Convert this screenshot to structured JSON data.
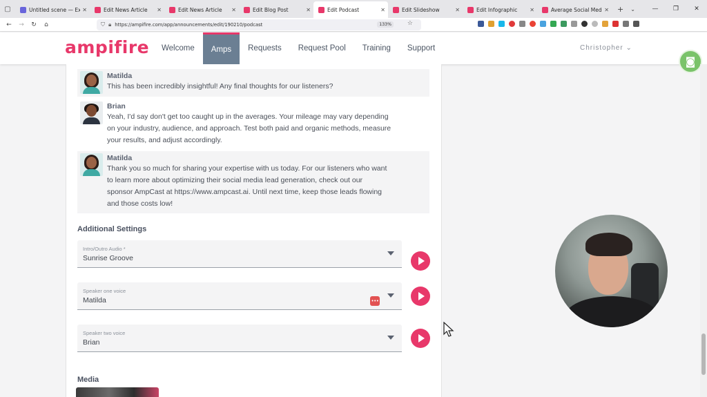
{
  "browser": {
    "tabs": [
      {
        "title": "Untitled scene — Excalidraw",
        "favicon_color": "#6965db",
        "active": false
      },
      {
        "title": "Edit News Article",
        "favicon_color": "#e8386a",
        "active": false
      },
      {
        "title": "Edit News Article",
        "favicon_color": "#e8386a",
        "active": false
      },
      {
        "title": "Edit Blog Post",
        "favicon_color": "#e8386a",
        "active": false
      },
      {
        "title": "Edit Podcast",
        "favicon_color": "#e8386a",
        "active": true
      },
      {
        "title": "Edit Slideshow",
        "favicon_color": "#e8386a",
        "active": false
      },
      {
        "title": "Edit Infographic",
        "favicon_color": "#e8386a",
        "active": false
      },
      {
        "title": "Average Social Media Cost",
        "favicon_color": "#e8386a",
        "active": false
      }
    ],
    "url": "https://ampifire.com/app/announcements/edit/190210/podcast",
    "zoom": "133%"
  },
  "header": {
    "logo": "ampifire",
    "menu": [
      "Welcome",
      "Amps",
      "Requests",
      "Request Pool",
      "Training",
      "Support"
    ],
    "active_menu": "Amps",
    "user": "Christopher",
    "brand_color": "#e8386a"
  },
  "transcript": [
    {
      "speaker": "Matilda",
      "avatar": "female-avatar",
      "lines": [
        "This has been incredibly insightful! Any final thoughts for our listeners?"
      ]
    },
    {
      "speaker": "Brian",
      "avatar": "male-avatar",
      "lines": [
        "Yeah, I'd say don't get too caught up in the averages. Your mileage may vary depending",
        "on your industry, audience, and approach. Test both paid and organic methods, measure",
        "your results, and adjust accordingly."
      ]
    },
    {
      "speaker": "Matilda",
      "avatar": "female-avatar",
      "lines": [
        "Thank you so much for sharing your expertise with us today. For our listeners who want",
        "to learn more about optimizing their social media lead generation, check out our",
        "sponsor AmpCast at https://www.ampcast.ai. Until next time, keep those leads flowing",
        "and those costs low!"
      ]
    }
  ],
  "settings": {
    "title": "Additional Settings",
    "fields": [
      {
        "label": "Intro/Outro Audio *",
        "value": "Sunrise Groove"
      },
      {
        "label": "Speaker one voice",
        "value": "Matilda"
      },
      {
        "label": "Speaker two voice",
        "value": "Brian"
      }
    ]
  },
  "media": {
    "title": "Media"
  }
}
